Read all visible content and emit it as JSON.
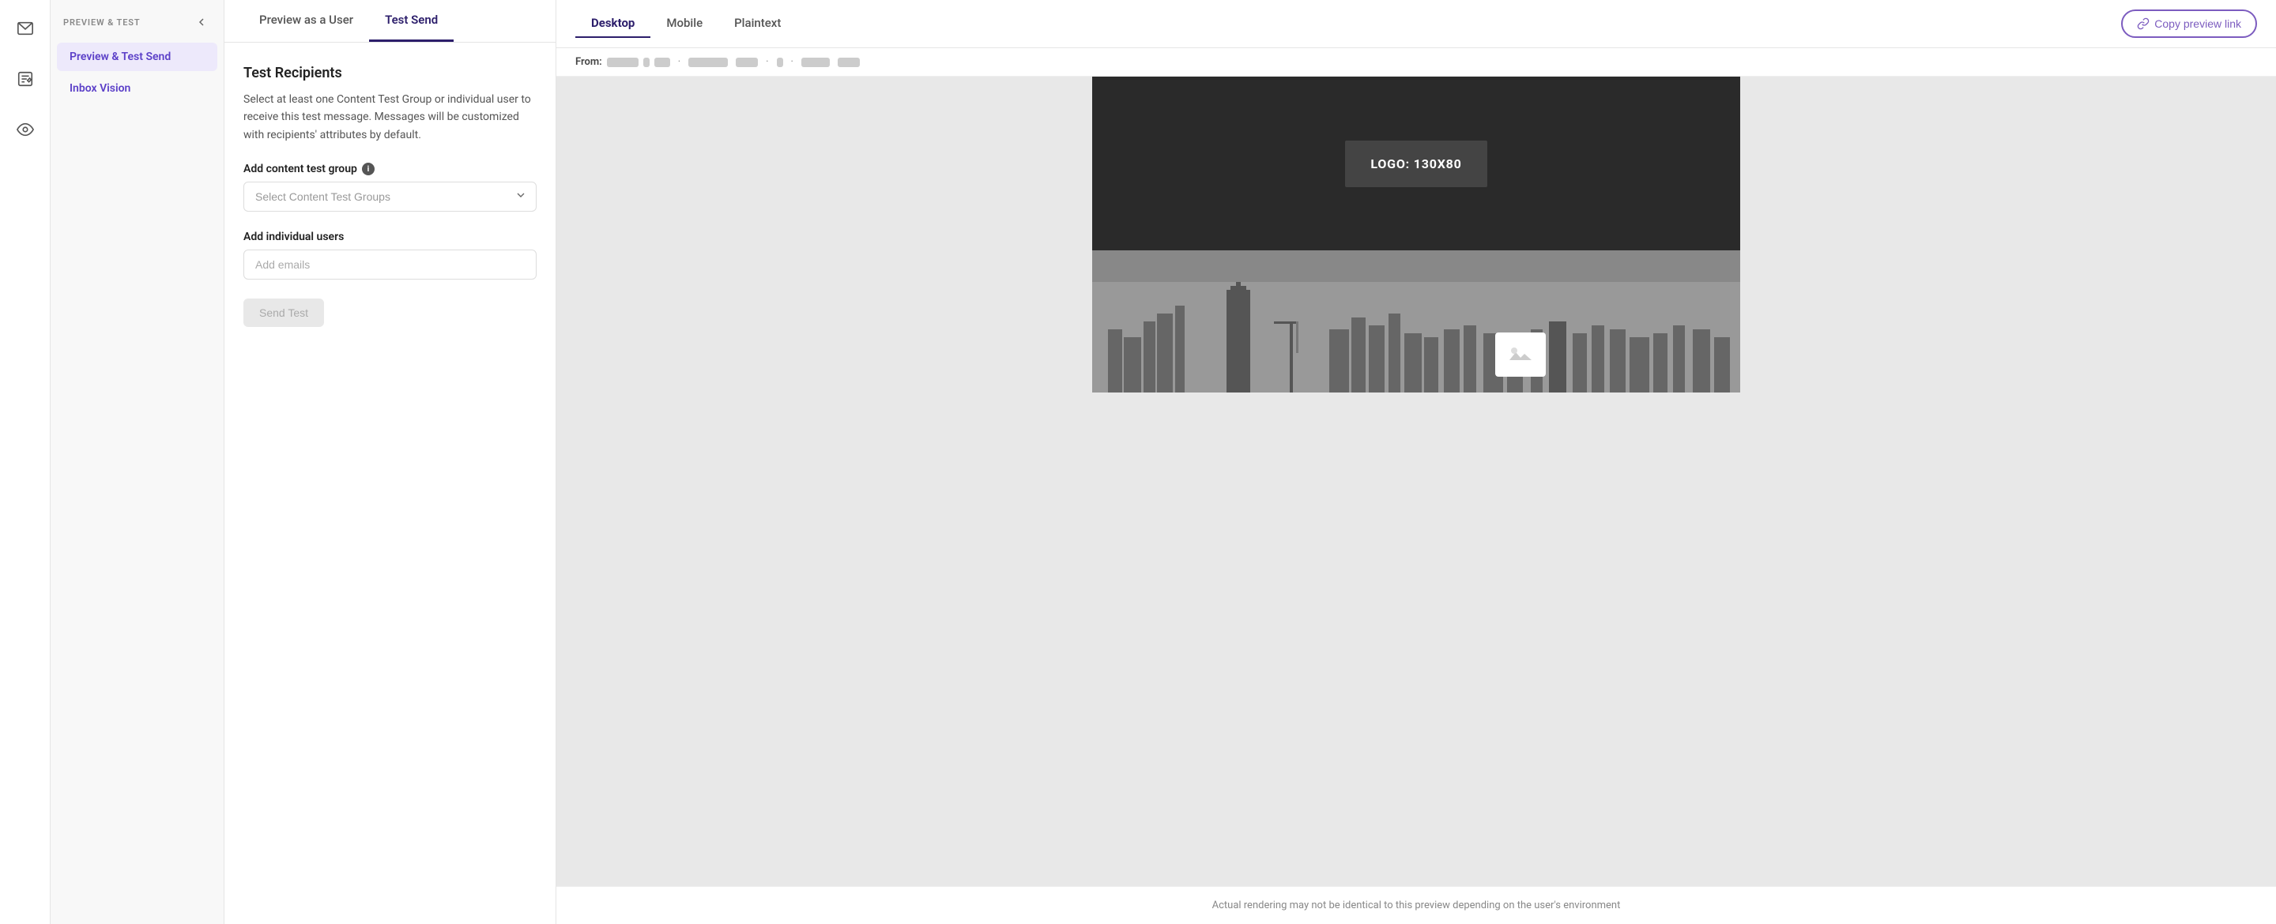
{
  "iconBar": {
    "icons": [
      {
        "name": "mail-icon",
        "label": "Mail"
      },
      {
        "name": "edit-icon",
        "label": "Edit"
      },
      {
        "name": "eye-icon",
        "label": "Preview"
      }
    ]
  },
  "sidebar": {
    "sectionLabel": "Preview & Test",
    "navItems": [
      {
        "id": "preview-test-send",
        "label": "Preview & Test Send",
        "active": true
      },
      {
        "id": "inbox-vision",
        "label": "Inbox Vision",
        "active": false
      }
    ]
  },
  "tabs": [
    {
      "id": "preview-as-user",
      "label": "Preview as a User",
      "active": false
    },
    {
      "id": "test-send",
      "label": "Test Send",
      "active": true
    }
  ],
  "form": {
    "title": "Test Recipients",
    "description": "Select at least one Content Test Group or individual user to receive this test message. Messages will be customized with recipients' attributes by default.",
    "contentTestGroupLabel": "Add content test group",
    "contentTestGroupPlaceholder": "Select Content Test Groups",
    "individualUsersLabel": "Add individual users",
    "individualUsersPlaceholder": "Add emails",
    "sendTestLabel": "Send Test"
  },
  "previewHeader": {
    "tabs": [
      {
        "id": "desktop",
        "label": "Desktop",
        "active": true
      },
      {
        "id": "mobile",
        "label": "Mobile",
        "active": false
      },
      {
        "id": "plaintext",
        "label": "Plaintext",
        "active": false
      }
    ],
    "copyLinkLabel": "Copy preview link"
  },
  "fromBar": {
    "label": "From:",
    "senderBlocks": [
      14,
      8,
      4,
      22,
      10,
      6,
      4,
      18,
      8
    ]
  },
  "emailPreview": {
    "logoText": "LOGO: 130X80"
  },
  "footerNote": "Actual rendering may not be identical to this preview depending on the user's environment"
}
